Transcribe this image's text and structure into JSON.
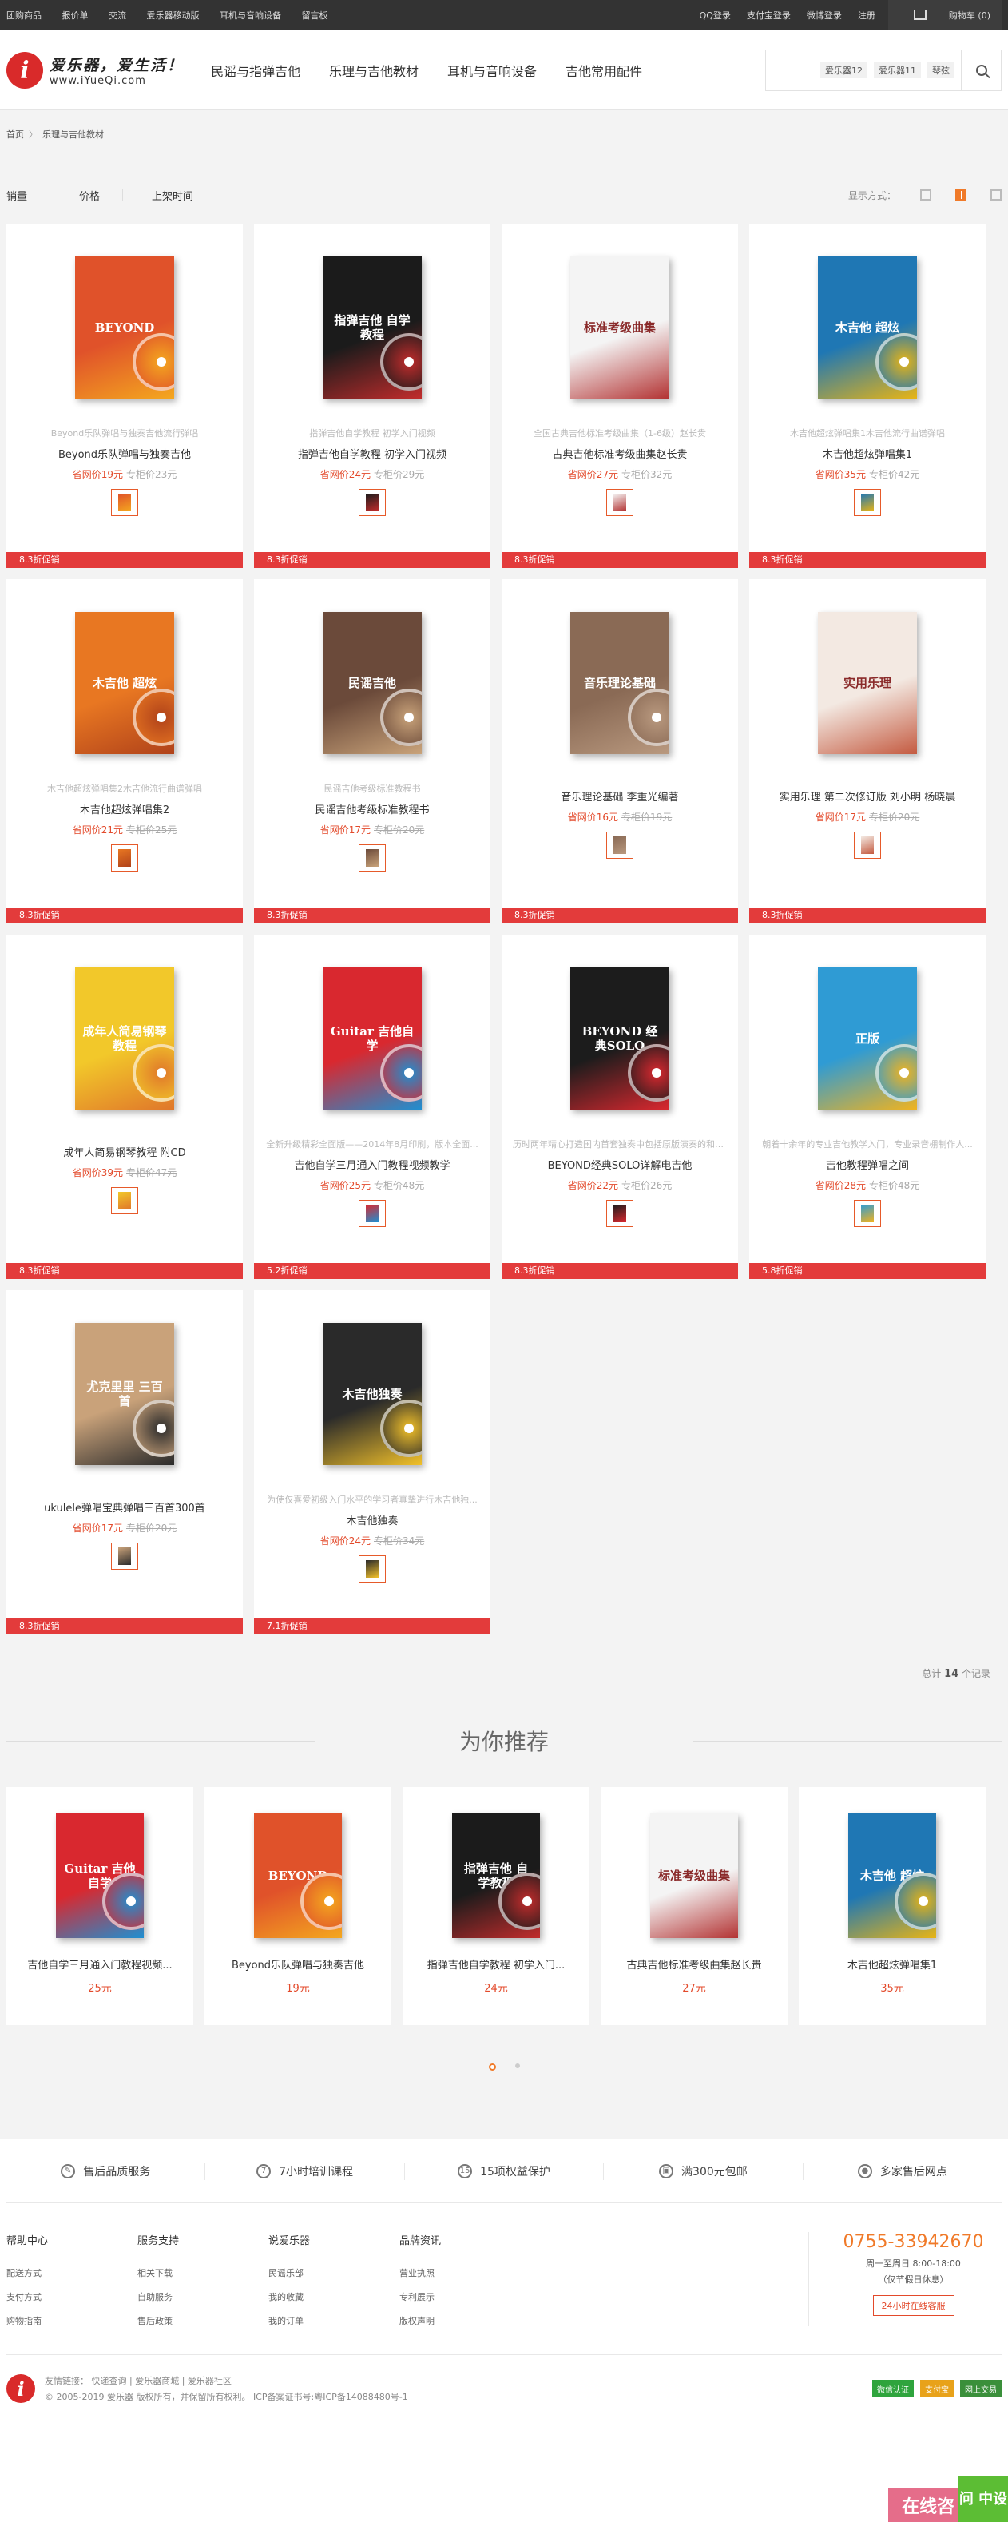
{
  "topbar": {
    "links": [
      "团购商品",
      "报价单",
      "交流",
      "爱乐器移动版",
      "耳机与音响设备",
      "留言板"
    ],
    "right": [
      "QQ登录",
      "支付宝登录",
      "微博登录",
      "注册"
    ],
    "cart": "购物车 (0)"
  },
  "logo": {
    "mark": "i",
    "line1": "爱乐器，爱生活！",
    "line2": "www.iYueQi.com"
  },
  "nav": [
    "民谣与指弹吉他",
    "乐理与吉他教材",
    "耳机与音响设备",
    "吉他常用配件"
  ],
  "search": {
    "tags": [
      "爱乐器12",
      "爱乐器11",
      "琴弦"
    ]
  },
  "breadcrumb": {
    "home": "首页",
    "sep": "〉",
    "current": "乐理与吉他教材"
  },
  "sortbar": {
    "sorts": [
      "销量",
      "价格",
      "上架时间"
    ],
    "display_label": "显示方式："
  },
  "products": [
    {
      "desc": "Beyond乐队弹唱与独奏吉他流行弹唱",
      "title": "Beyond乐队弹唱与独奏吉他",
      "price": "省网价19元",
      "mprice": "专柜价23元",
      "promo": "8.3折促销",
      "cover_title": "BEYOND",
      "c1": "#e0522a",
      "c2": "#f4a71f"
    },
    {
      "desc": "指弹吉他自学教程 初学入门视频",
      "title": "指弹吉他自学教程 初学入门视频",
      "price": "省网价24元",
      "mprice": "专柜价29元",
      "promo": "8.3折促销",
      "cover_title": "指弹吉他 自学教程",
      "c1": "#1b1b1b",
      "c2": "#c12c2c"
    },
    {
      "desc": "全国古典吉他标准考级曲集（1-6级）赵长贵",
      "title": "古典吉他标准考级曲集赵长贵",
      "price": "省网价27元",
      "mprice": "专柜价32元",
      "promo": "8.3折促销",
      "cover_title": "标准考级曲集",
      "c1": "#f4f4f4",
      "c2": "#b33333"
    },
    {
      "desc": "木吉他超炫弹唱集1木吉他流行曲谱弹唱",
      "title": "木吉他超炫弹唱集1",
      "price": "省网价35元",
      "mprice": "专柜价42元",
      "promo": "8.3折促销",
      "cover_title": "木吉他 超炫",
      "c1": "#1f77b4",
      "c2": "#e7b416"
    },
    {
      "desc": "木吉他超炫弹唱集2木吉他流行曲谱弹唱",
      "title": "木吉他超炫弹唱集2",
      "price": "省网价21元",
      "mprice": "专柜价25元",
      "promo": "8.3折促销",
      "cover_title": "木吉他 超炫",
      "c1": "#e87722",
      "c2": "#b0421a"
    },
    {
      "desc": "民谣吉他考级标准教程书",
      "title": "民谣吉他考级标准教程书",
      "price": "省网价17元",
      "mprice": "专柜价20元",
      "promo": "8.3折促销",
      "cover_title": "民谣吉他",
      "c1": "#6b4a3a",
      "c2": "#c9a37a"
    },
    {
      "desc": "",
      "title": "音乐理论基础 李重光编著",
      "price": "省网价16元",
      "mprice": "专柜价19元",
      "promo": "8.3折促销",
      "cover_title": "音乐理论基础",
      "c1": "#8a6a55",
      "c2": "#b9997f"
    },
    {
      "desc": "",
      "title": "实用乐理 第二次修订版 刘小明 杨晓晨",
      "price": "省网价17元",
      "mprice": "专柜价20元",
      "promo": "8.3折促销",
      "cover_title": "实用乐理",
      "c1": "#f3e9e2",
      "c2": "#c45a40"
    },
    {
      "desc": "",
      "title": "成年人简易钢琴教程 附CD",
      "price": "省网价39元",
      "mprice": "专柜价47元",
      "promo": "8.3折促销",
      "cover_title": "成年人简易钢琴教程",
      "c1": "#f2c82a",
      "c2": "#e0772a"
    },
    {
      "desc": "全新升级精彩全面版——2014年8月印刷，版本全面...",
      "title": "吉他自学三月通入门教程视频教学",
      "price": "省网价25元",
      "mprice": "专柜价48元",
      "promo": "5.2折促销",
      "cover_title": "Guitar 吉他自学",
      "c1": "#d9282f",
      "c2": "#1f8fd1"
    },
    {
      "desc": "历时两年精心打造国内首套独奏中包括原版演奏的和弦...",
      "title": "BEYOND经典SOLO详解电吉他",
      "price": "省网价22元",
      "mprice": "专柜价26元",
      "promo": "8.3折促销",
      "cover_title": "BEYOND 经典SOLO",
      "c1": "#1c1c1c",
      "c2": "#d9282f"
    },
    {
      "desc": "朝着十余年的专业吉他教学入门，专业录音棚制作人...",
      "title": "吉他教程弹唱之间",
      "price": "省网价28元",
      "mprice": "专柜价48元",
      "promo": "5.8折促销",
      "cover_title": "正版",
      "c1": "#2f9bd4",
      "c2": "#f0b31f"
    },
    {
      "desc": "",
      "title": "ukulele弹唱宝典弹唱三百首300首",
      "price": "省网价17元",
      "mprice": "专柜价20元",
      "promo": "8.3折促销",
      "cover_title": "尤克里里 三百首",
      "c1": "#c9a27a",
      "c2": "#2b2b2b"
    },
    {
      "desc": "为使仅喜爱初级入门水平的学习者真挚进行木吉他独...",
      "title": "木吉他独奏",
      "price": "省网价24元",
      "mprice": "专柜价34元",
      "promo": "7.1折促销",
      "cover_title": "木吉他独奏",
      "c1": "#2a2a2a",
      "c2": "#f2c12a"
    }
  ],
  "total": {
    "prefix": "总计",
    "count": "14",
    "suffix": "个记录"
  },
  "recommend": {
    "heading": "为你推荐",
    "items": [
      {
        "title": "吉他自学三月通入门教程视频...",
        "price": "25元",
        "cover_title": "Guitar 吉他自学",
        "c1": "#d9282f",
        "c2": "#1f8fd1"
      },
      {
        "title": "Beyond乐队弹唱与独奏吉他",
        "price": "19元",
        "cover_title": "BEYOND",
        "c1": "#e0522a",
        "c2": "#f4a71f"
      },
      {
        "title": "指弹吉他自学教程 初学入门...",
        "price": "24元",
        "cover_title": "指弹吉他 自学教程",
        "c1": "#1b1b1b",
        "c2": "#c12c2c"
      },
      {
        "title": "古典吉他标准考级曲集赵长贵",
        "price": "27元",
        "cover_title": "标准考级曲集",
        "c1": "#f4f4f4",
        "c2": "#b33333"
      },
      {
        "title": "木吉他超炫弹唱集1",
        "price": "35元",
        "cover_title": "木吉他 超炫",
        "c1": "#1f77b4",
        "c2": "#e7b416"
      }
    ]
  },
  "features": [
    "售后品质服务",
    "7小时培训课程",
    "15项权益保护",
    "满300元包邮",
    "多家售后网点"
  ],
  "footer_cols": [
    {
      "head": "帮助中心",
      "items": [
        "配送方式",
        "支付方式",
        "购物指南"
      ]
    },
    {
      "head": "服务支持",
      "items": [
        "相关下载",
        "自助服务",
        "售后政策"
      ]
    },
    {
      "head": "说爱乐器",
      "items": [
        "民谣乐部",
        "我的收藏",
        "我的订单"
      ]
    },
    {
      "head": "品牌资讯",
      "items": [
        "营业执照",
        "专利展示",
        "版权声明"
      ]
    }
  ],
  "contact": {
    "phone": "0755-33942670",
    "hours": "周一至周日 8:00-18:00",
    "holiday": "（仅节假日休息）",
    "service": "24小时在线客服"
  },
  "copyright": {
    "links": "友情链接：  快递查询 | 爱乐器商城 | 爱乐器社区",
    "text": "© 2005-2019 爱乐器 版权所有，并保留所有权利。 ICP备案证书号:粤ICP备14088480号-1"
  },
  "badges": [
    "微信认证",
    "支付宝",
    "网上交易"
  ],
  "float": {
    "online": "在线咨",
    "qa": "问 中设"
  }
}
